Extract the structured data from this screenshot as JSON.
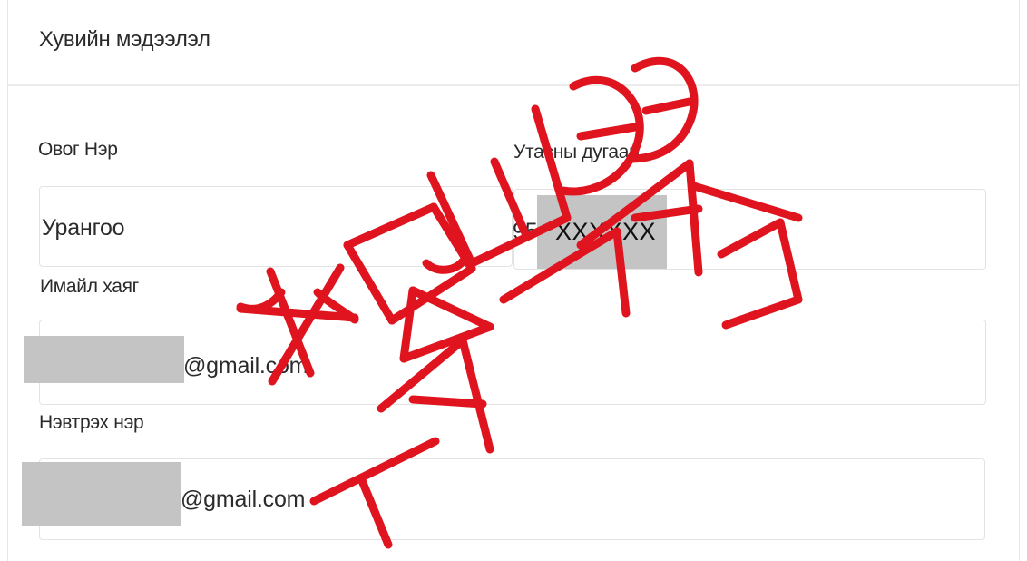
{
  "section": {
    "title": "Хувийн мэдээлэл"
  },
  "fields": {
    "name": {
      "label": "Овог Нэр",
      "value": "Урангоо"
    },
    "phone": {
      "label": "Утасны дугаар",
      "value_prefix": "95",
      "masked": "XXXXXX"
    },
    "email": {
      "label": "Имайл хаяг",
      "value_suffix": "@gmail.com"
    },
    "username": {
      "label": "Нэвтрэх нэр",
      "value_suffix": "@gmail.com"
    }
  },
  "watermark": {
    "line1": "ЖИШЭЭ",
    "line2": "ТАЙЛАН",
    "color": "#e0141e"
  }
}
